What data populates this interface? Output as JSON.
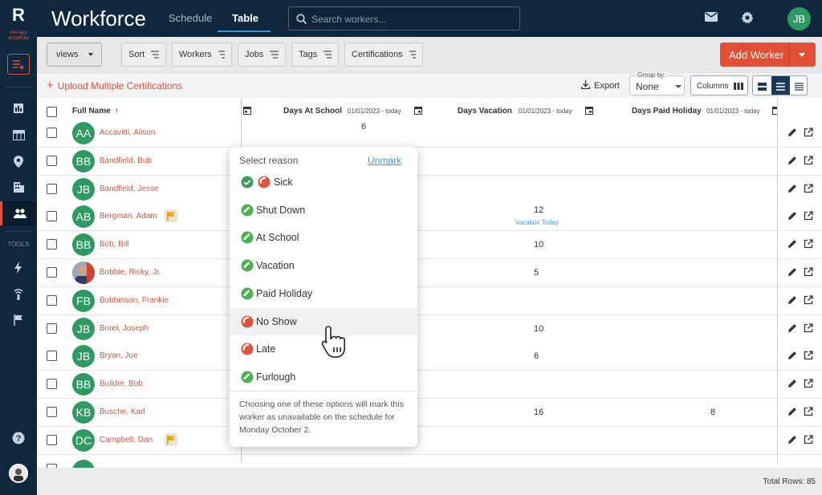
{
  "app": {
    "logo": "R",
    "env": "dev-app 4c5af63ef",
    "title": "Workforce"
  },
  "tabs": [
    {
      "label": "Schedule"
    },
    {
      "label": "Table"
    }
  ],
  "search": {
    "placeholder": "Search workers..."
  },
  "user": {
    "initials": "JB"
  },
  "rail": {
    "tools_label": "TOOLS"
  },
  "toolbar": {
    "views": "views",
    "sort": "Sort",
    "workers": "Workers",
    "jobs": "Jobs",
    "tags": "Tags",
    "certifications": "Certifications",
    "add_worker": "Add Worker"
  },
  "subbar": {
    "upload": "Upload Multiple Certifications",
    "export": "Export",
    "group_by_label": "Group by:",
    "group_by_value": "None",
    "columns": "Columns"
  },
  "table": {
    "headers": {
      "full_name": "Full Name",
      "days_school": "Days At School",
      "days_school_range": "01/01/2023 - today",
      "days_vacation": "Days Vacation",
      "days_vacation_range": "01/01/2023 - today",
      "days_holiday": "Days Paid Holiday",
      "days_holiday_range": "01/01/2023 - today"
    },
    "rows": [
      {
        "initials": "AA",
        "name": "Accavitti, Alison",
        "school": "6",
        "vacation": "",
        "vacation_sub": "",
        "holiday": "",
        "flag": false
      },
      {
        "initials": "BB",
        "name": "Bandfield, Bub",
        "school": "",
        "vacation": "",
        "vacation_sub": "",
        "holiday": "",
        "flag": false
      },
      {
        "initials": "JB",
        "name": "Bandfield, Jesse",
        "school": "",
        "vacation": "",
        "vacation_sub": "",
        "holiday": "",
        "flag": false
      },
      {
        "initials": "AB",
        "name": "Bergman, Adam",
        "school": "",
        "vacation": "12",
        "vacation_sub": "Vacation Today",
        "holiday": "",
        "flag": true
      },
      {
        "initials": "BB",
        "name": "Bob, Bill",
        "school": "",
        "vacation": "10",
        "vacation_sub": "",
        "holiday": "",
        "flag": false
      },
      {
        "initials": "",
        "name": "Bobbie, Ricky, Jr.",
        "school": "",
        "vacation": "5",
        "vacation_sub": "",
        "holiday": "",
        "flag": false,
        "photo": true
      },
      {
        "initials": "FB",
        "name": "Bobbinson, Frankie",
        "school": "",
        "vacation": "",
        "vacation_sub": "",
        "holiday": "",
        "flag": false
      },
      {
        "initials": "JB",
        "name": "Borel, Joseph",
        "school": "",
        "vacation": "10",
        "vacation_sub": "",
        "holiday": "",
        "flag": false
      },
      {
        "initials": "JB",
        "name": "Bryan, Joe",
        "school": "",
        "vacation": "6",
        "vacation_sub": "",
        "holiday": "",
        "flag": false
      },
      {
        "initials": "BB",
        "name": "Builder, Bob",
        "school": "",
        "vacation": "",
        "vacation_sub": "",
        "holiday": "",
        "flag": false
      },
      {
        "initials": "KB",
        "name": "Busche, Karl",
        "school": "",
        "vacation": "16",
        "vacation_sub": "",
        "holiday": "8",
        "flag": false
      },
      {
        "initials": "DC",
        "name": "Campbell, Dan",
        "school": "",
        "vacation": "",
        "vacation_sub": "",
        "holiday": "",
        "flag": true
      }
    ],
    "total_rows": "Total Rows: 85"
  },
  "popup": {
    "header": "Select reason",
    "unmark": "Unmark",
    "options": [
      {
        "label": "Sick",
        "type": "red",
        "checked": true
      },
      {
        "label": "Shut Down",
        "type": "green"
      },
      {
        "label": "At School",
        "type": "green"
      },
      {
        "label": "Vacation",
        "type": "green"
      },
      {
        "label": "Paid Holiday",
        "type": "green"
      },
      {
        "label": "No Show",
        "type": "red",
        "hover": true
      },
      {
        "label": "Late",
        "type": "red"
      },
      {
        "label": "Furlough",
        "type": "green"
      }
    ],
    "note": "Choosing one of these options will mark this worker as unavailable on the schedule for Monday October 2."
  },
  "colors": {
    "brand_red": "#e24f35",
    "nav_dark": "#10283d",
    "avatar_green": "#2e9a62",
    "link_blue": "#3b98d4"
  }
}
